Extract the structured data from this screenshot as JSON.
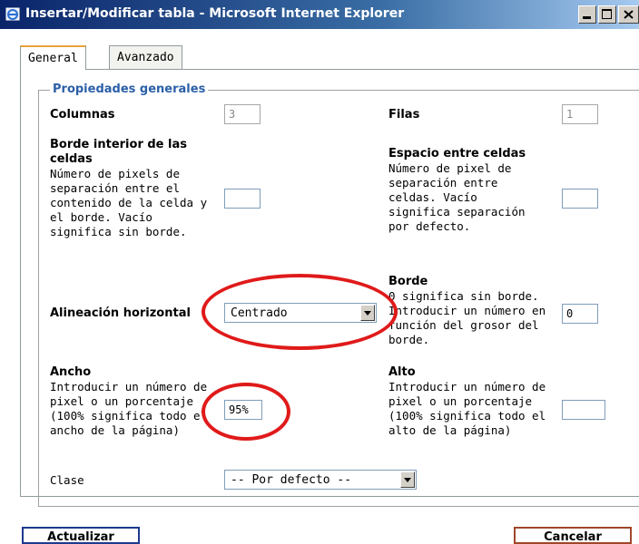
{
  "window": {
    "title": "Insertar/Modificar tabla - Microsoft Internet Explorer"
  },
  "tabs": [
    {
      "label": "General",
      "active": true
    },
    {
      "label": "Avanzado",
      "active": false
    }
  ],
  "section": {
    "legend": "Propiedades generales"
  },
  "fields": {
    "columnas": {
      "label": "Columnas",
      "value": "3"
    },
    "filas": {
      "label": "Filas",
      "value": "1"
    },
    "borde_interior": {
      "label": "Borde interior de las celdas",
      "desc": "Número de pixels de separación entre el contenido de la celda y el borde. Vacío significa sin borde.",
      "value": ""
    },
    "espacio_celdas": {
      "label": "Espacio entre celdas",
      "desc": "Número de pixel de separación entre celdas. Vacío significa separación por defecto.",
      "value": ""
    },
    "alineacion": {
      "label": "Alineación horizontal",
      "value": "Centrado"
    },
    "borde": {
      "label": "Borde",
      "desc": "0 significa sin borde. Introducir un número en función del grosor del borde.",
      "value": "0"
    },
    "ancho": {
      "label": "Ancho",
      "desc": "Introducir un número de pixel o un porcentaje (100% significa todo el ancho de la página)",
      "value": "95%"
    },
    "alto": {
      "label": "Alto",
      "desc": "Introducir un número de pixel o un porcentaje (100% significa todo el alto de la página)",
      "value": ""
    },
    "clase": {
      "label": "Clase",
      "value": "-- Por defecto --"
    }
  },
  "buttons": {
    "update": "Actualizar",
    "cancel": "Cancelar"
  },
  "colors": {
    "highlight_ring": "#e01a1a",
    "legend_text": "#2b5fa8",
    "title_bar": "#0a246a"
  }
}
